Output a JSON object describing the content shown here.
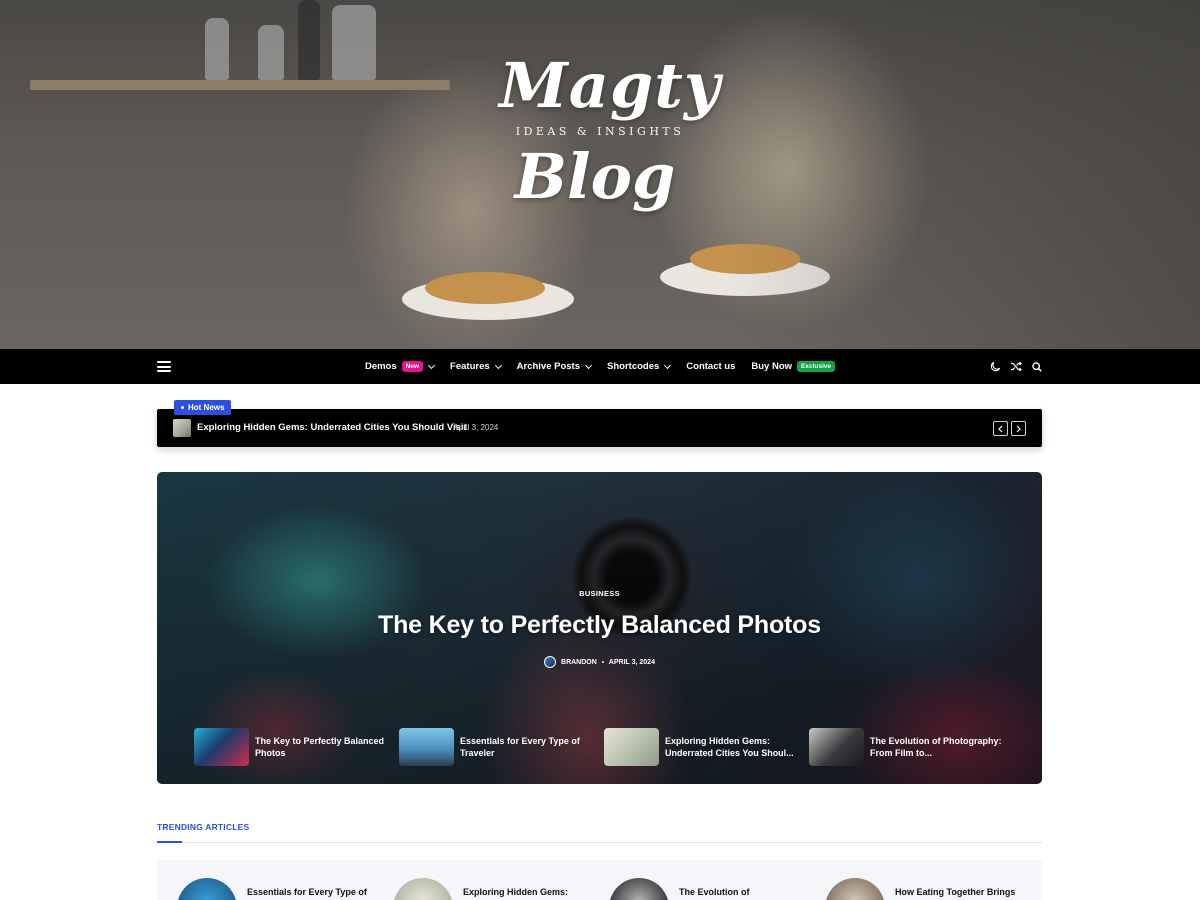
{
  "site": {
    "logo_top": "Magty",
    "logo_tagline": "IDEAS & INSIGHTS",
    "logo_bottom": "Blog"
  },
  "nav": {
    "items": [
      {
        "label": "Demos",
        "badge": "New",
        "dropdown": true
      },
      {
        "label": "Features",
        "dropdown": true
      },
      {
        "label": "Archive Posts",
        "dropdown": true
      },
      {
        "label": "Shortcodes",
        "dropdown": true
      },
      {
        "label": "Contact us",
        "dropdown": false
      },
      {
        "label": "Buy Now",
        "badge": "Exclusive",
        "dropdown": false
      }
    ],
    "icons": [
      "menu-icon",
      "moon-icon",
      "shuffle-icon",
      "search-icon"
    ]
  },
  "ticker": {
    "badge": "Hot News",
    "title": "Exploring Hidden Gems: Underrated Cities You Should Visit",
    "date": "April 3, 2024"
  },
  "featured": {
    "category": "BUSINESS",
    "title": "The Key to Perfectly Balanced Photos",
    "author": "BRANDON",
    "date": "APRIL 3, 2024",
    "mini_posts": [
      {
        "title": "The Key to Perfectly Balanced Photos"
      },
      {
        "title": "Essentials for Every Type of Traveler"
      },
      {
        "title": "Exploring Hidden Gems: Underrated Cities You Shoul..."
      },
      {
        "title": "The Evolution of Photography: From Film to..."
      }
    ]
  },
  "trending": {
    "heading": "TRENDING ARTICLES",
    "items": [
      {
        "title": "Essentials for Every Type of"
      },
      {
        "title": "Exploring Hidden Gems: Underrated Cities You Should"
      },
      {
        "title": "The Evolution of Photography: From Film to Digital and"
      },
      {
        "title": "How Eating Together Brings"
      }
    ]
  },
  "colors": {
    "accent": "#2d4fe0",
    "badge_new": "#e4148c",
    "badge_exclusive": "#12a447",
    "nav_bg": "#000000"
  }
}
